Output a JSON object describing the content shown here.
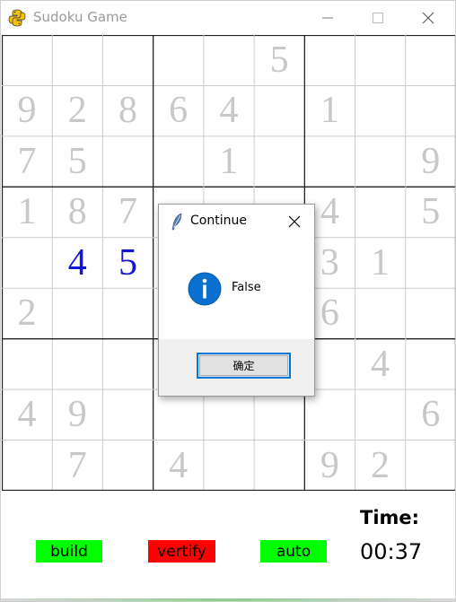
{
  "window": {
    "title": "Sudoku Game",
    "icons": {
      "app": "python-icon",
      "minimize": "minimize-icon",
      "maximize": "maximize-icon",
      "close": "close-icon"
    }
  },
  "board": {
    "given_color": "#c8c8c8",
    "user_color": "#1414d8",
    "grid_color_thin": "#cccccc",
    "grid_color_thick": "#222222",
    "cells": [
      [
        "",
        "",
        "",
        "",
        "",
        "5",
        "",
        "",
        ""
      ],
      [
        "9",
        "2",
        "8",
        "6",
        "4",
        "",
        "1",
        "",
        ""
      ],
      [
        "7",
        "5",
        "",
        "",
        "1",
        "",
        "",
        "",
        "9"
      ],
      [
        "1",
        "8",
        "7",
        "",
        "",
        "",
        "4",
        "",
        "5"
      ],
      [
        "",
        "4",
        "5",
        "",
        "",
        "",
        "3",
        "1",
        ""
      ],
      [
        "2",
        "",
        "",
        "",
        "",
        "",
        "6",
        "",
        ""
      ],
      [
        "",
        "",
        "",
        "",
        "",
        "",
        "",
        "4",
        ""
      ],
      [
        "4",
        "9",
        "",
        "",
        "",
        "",
        "",
        "",
        "6"
      ],
      [
        "",
        "7",
        "",
        "4",
        "",
        "",
        "9",
        "2",
        ""
      ]
    ],
    "user_cells": [
      [
        4,
        1
      ],
      [
        4,
        2
      ]
    ]
  },
  "controls": {
    "build_label": "build",
    "verify_label": "vertify",
    "auto_label": "auto",
    "time_label": "Time:",
    "time_value": "00:37",
    "colors": {
      "build": "#00ff00",
      "verify": "#ff0000",
      "auto": "#00ff00"
    }
  },
  "dialog": {
    "title": "Continue",
    "message": "False",
    "ok_label": "确定",
    "icons": {
      "title": "feather-icon",
      "info": "info-icon",
      "close": "close-icon"
    },
    "info_color": "#0078d7"
  }
}
